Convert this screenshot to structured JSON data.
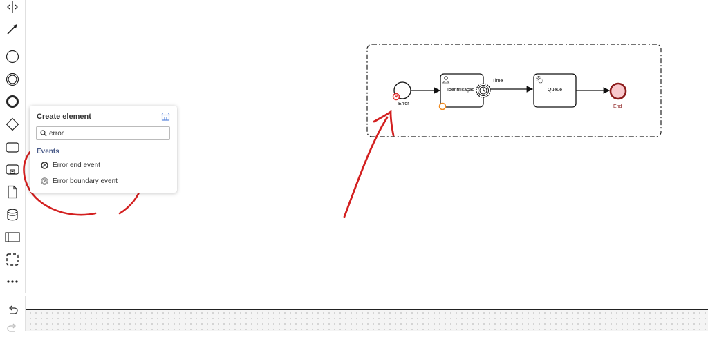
{
  "palette": {
    "tools": [
      {
        "name": "hand-tool",
        "icon": "hand-icon"
      },
      {
        "name": "global-connect-tool",
        "icon": "arrow-icon"
      },
      {
        "name": "start-event",
        "icon": "circle-thin-icon"
      },
      {
        "name": "intermediate-event",
        "icon": "circle-double-icon"
      },
      {
        "name": "end-event",
        "icon": "circle-thick-icon"
      },
      {
        "name": "gateway",
        "icon": "diamond-icon"
      },
      {
        "name": "task",
        "icon": "rounded-rect-icon"
      },
      {
        "name": "subprocess",
        "icon": "subprocess-icon"
      },
      {
        "name": "data-object",
        "icon": "document-icon"
      },
      {
        "name": "data-store",
        "icon": "database-icon"
      },
      {
        "name": "participant",
        "icon": "pool-icon"
      },
      {
        "name": "group",
        "icon": "dashed-rect-icon"
      },
      {
        "name": "more",
        "icon": "ellipsis-icon"
      }
    ],
    "undo_icon": "undo-icon",
    "redo_icon": "redo-icon"
  },
  "popup": {
    "title": "Create element",
    "search_value": "error",
    "group": "Events",
    "entries": [
      {
        "label": "Error end event",
        "icon": "error-end-event-icon"
      },
      {
        "label": "Error boundary event",
        "icon": "error-boundary-event-icon"
      }
    ]
  },
  "diagram": {
    "start_event_label": "Error",
    "task1_label": "Identificação",
    "flow_label": "Time",
    "task2_label": "Queue",
    "end_event_label": "End"
  },
  "colors": {
    "annotation_red": "#d32020",
    "error_marker": "#e03030",
    "end_event_fill": "#f8c8cc",
    "end_event_stroke": "#8b1a1a",
    "boundary_orange": "#f28a1e",
    "popup_accent": "#4a7bd8"
  }
}
